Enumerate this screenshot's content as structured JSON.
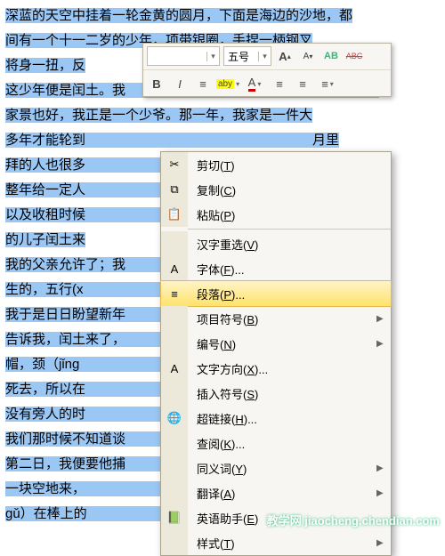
{
  "doc": {
    "lines": [
      "深蓝的天空中挂着一轮金黄的圆月，下面是海边的沙地，都",
      "间有一个十一二岁的少年，项带银圈，手捏一柄钢叉",
      "将身一扭，反",
      "这少年便是闰土。我　　　　　　　　　　　　　　　　将有三",
      "家景也好，我正是一个少爷。那一年，我家是一件大",
      "多年才能轮到　　　　　　　　　　　　　　　　　月里",
      "拜的人也很多　　　　　　　　　　　　　　　　个忙月",
      "整年给一定人　　　　　　　　　　　　　　　　的，叫短",
      "以及收租时候　　　　　　　　　　　　　　　　忙不",
      "的儿子闰土来",
      "我的父亲允许了；我　　　　　　　　　　　　　　　名字，他",
      "生的，五行(x　　　　　　　　　　　　　　　　土。他",
      "我于是日日盼望新年　　　　　　　　　　　　　　　到了",
      "告诉我，闰土来了，　　　　　　　　　　　　　　　，紫色",
      "帽，颈（jǐng　　　　　　　　　　　　　　　　，",
      "死去，所以在　　　　　　　　　　　　　　　　套住了",
      "没有旁人的时　　　　　　　　　　　　　　　　我们",
      "我们那时候不知道谈　　　　　　　　　　　　　　　上城之",
      "第二日，我便要他捕　　　　　　　　　　　　　　　了才好",
      "一块空地来，　　　　　　　　　　　　　　　　，",
      "gǔ）在棒上的　　　　　　　　　　　　　　　　家"
    ]
  },
  "toolbar": {
    "font": "",
    "size": "五号",
    "grow": "A",
    "shrink": "A",
    "styles": "AB",
    "clear": "ABC",
    "bold": "B",
    "italic": "I",
    "align": "≡",
    "highlight": "aby",
    "fontcolor": "A",
    "indentL": "≡",
    "indentR": "≡",
    "list": "≡"
  },
  "menu": {
    "items": [
      {
        "icon": "✂",
        "label": "剪切(T)"
      },
      {
        "icon": "⧉",
        "label": "复制(C)"
      },
      {
        "icon": "📋",
        "label": "粘贴(P)"
      },
      {
        "sep": true
      },
      {
        "icon": "",
        "label": "汉字重选(V)"
      },
      {
        "icon": "A",
        "label": "字体(F)..."
      },
      {
        "icon": "≡",
        "label": "段落(P)...",
        "hl": true
      },
      {
        "icon": "",
        "label": "项目符号(B)",
        "sub": true
      },
      {
        "icon": "",
        "label": "编号(N)",
        "sub": true
      },
      {
        "icon": "A",
        "label": "文字方向(X)..."
      },
      {
        "icon": "",
        "label": "插入符号(S)"
      },
      {
        "icon": "🌐",
        "label": "超链接(H)..."
      },
      {
        "icon": "",
        "label": "查阅(K)..."
      },
      {
        "icon": "",
        "label": "同义词(Y)",
        "sub": true
      },
      {
        "icon": "",
        "label": "翻译(A)",
        "sub": true
      },
      {
        "icon": "📗",
        "label": "英语助手(E)"
      },
      {
        "icon": "",
        "label": "样式(T)",
        "sub": true
      }
    ]
  },
  "wm": "教学网 jiaocheng.chendian.com"
}
